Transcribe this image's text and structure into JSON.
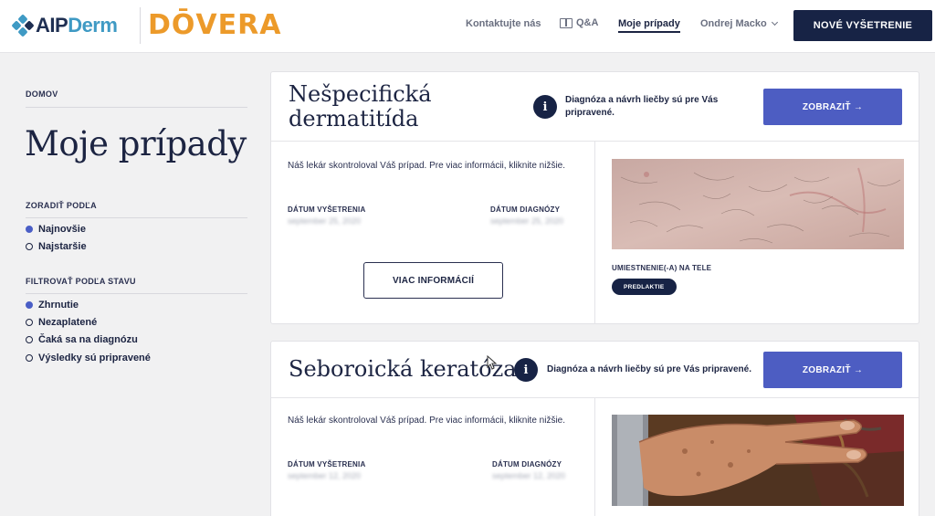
{
  "header": {
    "logo_aip": "AIP",
    "logo_derm": "Derm",
    "logo_dovera": "DŌVERA",
    "nav_contact": "Kontaktujte nás",
    "nav_qa": "Q&A",
    "nav_cases": "Moje prípady",
    "user_name": "Ondrej Macko",
    "new_exam_button": "NOVÉ VYŠETRENIE"
  },
  "sidebar": {
    "breadcrumb": "DOMOV",
    "title": "Moje prípady",
    "sort_heading": "ZORADIŤ PODĽA",
    "sort_options": [
      {
        "label": "Najnovšie",
        "selected": true
      },
      {
        "label": "Najstaršie",
        "selected": false
      }
    ],
    "filter_heading": "FILTROVAŤ PODĽA STAVU",
    "filter_options": [
      {
        "label": "Zhrnutie",
        "selected": true
      },
      {
        "label": "Nezaplatené",
        "selected": false
      },
      {
        "label": "Čaká sa na diagnózu",
        "selected": false
      },
      {
        "label": "Výsledky sú pripravené",
        "selected": false
      }
    ]
  },
  "cases": [
    {
      "title_line1": "Nešpecifická",
      "title_line2": "dermatitída",
      "info_line1": "Diagnóza a návrh liečby sú pre Vás",
      "info_line2": "pripravené.",
      "show_button": "ZOBRAZIŤ →",
      "review_text": "Náš lekár skontroloval Váš prípad. Pre viac informácii, kliknite nižšie.",
      "exam_date_label": "DÁTUM VYŠETRENIA",
      "exam_date_value": "september 25, 2020",
      "diag_date_label": "DÁTUM DIAGNÓZY",
      "diag_date_value": "september 25, 2020",
      "more_button": "VIAC INFORMÁCIÍ",
      "location_label": "UMIESTNENIE(-A) NA TELE",
      "location_value": "PREDLAKTIE"
    },
    {
      "title": "Seboroická keratóza",
      "info_text": "Diagnóza a návrh liečby sú pre Vás pripravené.",
      "show_button": "ZOBRAZIŤ →",
      "review_text": "Náš lekár skontroloval Váš prípad. Pre viac informácii, kliknite nižšie.",
      "exam_date_label": "DÁTUM VYŠETRENIA",
      "exam_date_value": "september 12, 2020",
      "diag_date_label": "DÁTUM DIAGNÓZY",
      "diag_date_value": "september 12, 2020"
    }
  ],
  "icons": {
    "info": "info-icon",
    "qa": "book-icon",
    "user_menu": "chevron-down-icon"
  },
  "colors": {
    "primary_navy": "#172345",
    "button_blue": "#4d5dc2",
    "dovera_orange": "#ec9a2a",
    "derm_blue": "#3f9ac4"
  }
}
